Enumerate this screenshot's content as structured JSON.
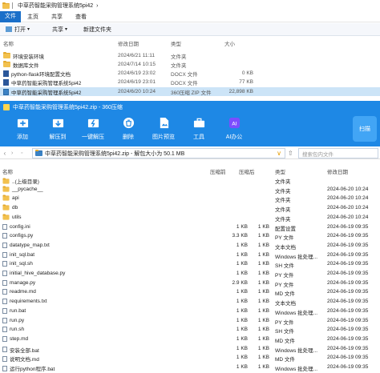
{
  "explorer": {
    "breadcrumb": "中草药智能采购管理系统5pi42",
    "breadcrumb_arrow": "›",
    "menu": [
      "文件",
      "主页",
      "共享",
      "查看"
    ],
    "toolbar": {
      "open_label": "打开",
      "open_arrow": "▾",
      "share_label": "共享",
      "share_arrow": "▾",
      "new_folder_label": "新建文件夹"
    },
    "columns": {
      "name": "名称",
      "date": "修改日期",
      "type": "类型",
      "size": "大小"
    },
    "rows": [
      {
        "name": "环境安装环境",
        "date": "2024/6/21 11:11",
        "type": "文件夹",
        "size": "",
        "icon": "folder-icon"
      },
      {
        "name": "数据库文件",
        "date": "2024/7/14 10:15",
        "type": "文件夹",
        "size": "",
        "icon": "folder-icon"
      },
      {
        "name": "python-flask环境配置文档",
        "date": "2024/6/19 23:02",
        "type": "DOCX 文件",
        "size": "0 KB",
        "icon": "word-document-icon"
      },
      {
        "name": "中草药智能采购管理系统5pi42",
        "date": "2024/6/19 23:01",
        "type": "DOCX 文件",
        "size": "77 KB",
        "icon": "word-document-icon"
      },
      {
        "name": "中草药智能采购管理系统5pi42",
        "date": "2024/6/20 10:24",
        "type": "360压缩 ZIP 文件",
        "size": "22,898 KB",
        "icon": "zip-archive-icon"
      }
    ]
  },
  "zip": {
    "window_title": "中草药智能采购管理系统5pi42.zip - 360压缩",
    "toolbar": [
      {
        "label": "添加",
        "icon": "add-icon"
      },
      {
        "label": "解压到",
        "icon": "extract-to-icon"
      },
      {
        "label": "一键解压",
        "icon": "one-click-extract-icon"
      },
      {
        "label": "删除",
        "icon": "delete-icon"
      },
      {
        "label": "图片预览",
        "icon": "image-preview-icon"
      },
      {
        "label": "工具",
        "icon": "tools-icon"
      },
      {
        "label": "AI办公",
        "icon": "ai-office-icon"
      }
    ],
    "scan_label": "扫描",
    "address": "中草药智能采购管理系统5pi42.zip - 解包大小为 50.1 MB",
    "address_chevron": "∨",
    "search_placeholder": "搜索包内文件",
    "columns": {
      "name": "名称",
      "compressed": "压缩前",
      "original": "压缩后",
      "type": "类型",
      "date": "修改日期"
    },
    "rows": [
      {
        "name": "..(上级目录)",
        "comp": "",
        "orig": "",
        "type": "文件夹",
        "date": "",
        "icon": "folder-icon"
      },
      {
        "name": "__pycache__",
        "comp": "",
        "orig": "",
        "type": "文件夹",
        "date": "2024-06-20 10:24",
        "icon": "folder-icon"
      },
      {
        "name": "api",
        "comp": "",
        "orig": "",
        "type": "文件夹",
        "date": "2024-06-20 10:24",
        "icon": "folder-icon"
      },
      {
        "name": "db",
        "comp": "",
        "orig": "",
        "type": "文件夹",
        "date": "2024-06-20 10:24",
        "icon": "folder-icon"
      },
      {
        "name": "utils",
        "comp": "",
        "orig": "",
        "type": "文件夹",
        "date": "2024-06-20 10:24",
        "icon": "folder-icon"
      },
      {
        "name": "config.ini",
        "comp": "1 KB",
        "orig": "1 KB",
        "type": "配置设置",
        "date": "2024-06-19 09:35",
        "icon": "file-icon"
      },
      {
        "name": "configs.py",
        "comp": "3.3 KB",
        "orig": "1 KB",
        "type": "PY 文件",
        "date": "2024-06-19 09:35",
        "icon": "file-icon"
      },
      {
        "name": "datatype_map.txt",
        "comp": "1 KB",
        "orig": "1 KB",
        "type": "文本文档",
        "date": "2024-06-19 09:35",
        "icon": "file-icon"
      },
      {
        "name": "init_sql.bat",
        "comp": "1 KB",
        "orig": "1 KB",
        "type": "Windows 批处理...",
        "date": "2024-06-19 09:35",
        "icon": "file-icon"
      },
      {
        "name": "init_sql.sh",
        "comp": "1 KB",
        "orig": "1 KB",
        "type": "SH 文件",
        "date": "2024-06-19 09:35",
        "icon": "file-icon"
      },
      {
        "name": "initial_hive_database.py",
        "comp": "1 KB",
        "orig": "1 KB",
        "type": "PY 文件",
        "date": "2024-06-19 09:35",
        "icon": "file-icon"
      },
      {
        "name": "manage.py",
        "comp": "2.9 KB",
        "orig": "1 KB",
        "type": "PY 文件",
        "date": "2024-06-19 09:35",
        "icon": "file-icon"
      },
      {
        "name": "readme.md",
        "comp": "1 KB",
        "orig": "1 KB",
        "type": "MD 文件",
        "date": "2024-06-19 09:35",
        "icon": "file-icon"
      },
      {
        "name": "requirements.txt",
        "comp": "1 KB",
        "orig": "1 KB",
        "type": "文本文档",
        "date": "2024-06-19 09:35",
        "icon": "file-icon"
      },
      {
        "name": "run.bat",
        "comp": "1 KB",
        "orig": "1 KB",
        "type": "Windows 批处理...",
        "date": "2024-06-19 09:35",
        "icon": "file-icon"
      },
      {
        "name": "run.py",
        "comp": "1 KB",
        "orig": "1 KB",
        "type": "PY 文件",
        "date": "2024-06-19 09:35",
        "icon": "file-icon"
      },
      {
        "name": "run.sh",
        "comp": "1 KB",
        "orig": "1 KB",
        "type": "SH 文件",
        "date": "2024-06-19 09:35",
        "icon": "file-icon"
      },
      {
        "name": "step.md",
        "comp": "1 KB",
        "orig": "1 KB",
        "type": "MD 文件",
        "date": "2024-06-19 09:35",
        "icon": "file-icon"
      },
      {
        "name": "安装全部.bat",
        "comp": "1 KB",
        "orig": "1 KB",
        "type": "Windows 批处理...",
        "date": "2024-06-19 09:35",
        "icon": "file-icon"
      },
      {
        "name": "说明文档.md",
        "comp": "1 KB",
        "orig": "1 KB",
        "type": "MD 文件",
        "date": "2024-06-19 09:35",
        "icon": "file-icon"
      },
      {
        "name": "运行python程序.bat",
        "comp": "1 KB",
        "orig": "1 KB",
        "type": "Windows 批处理...",
        "date": "2024-06-19 09:35",
        "icon": "file-icon"
      }
    ]
  },
  "colors": {
    "zip_blue": "#1e88e5",
    "selection": "#cce4f7",
    "folder": "#f2c14e",
    "accent_blue": "#1a6fc9"
  }
}
